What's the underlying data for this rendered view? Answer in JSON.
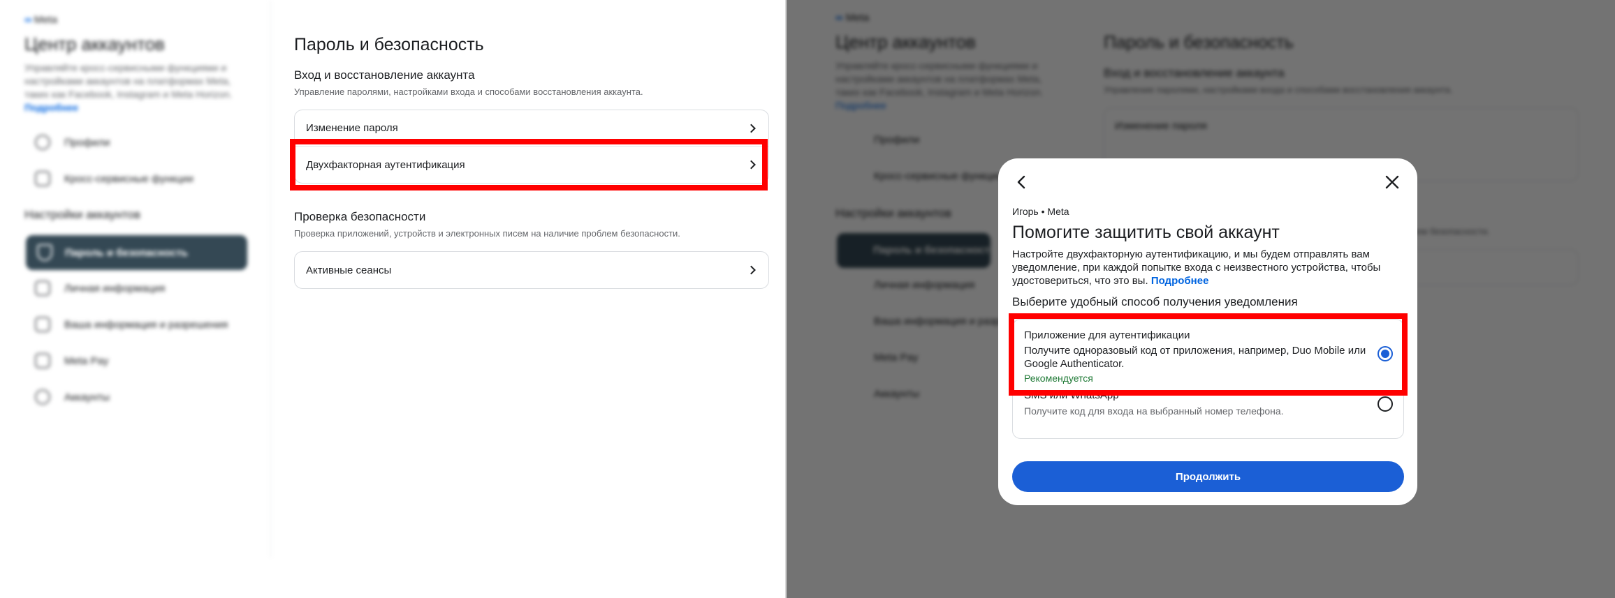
{
  "brand": {
    "logo_text": "Meta"
  },
  "sidebar": {
    "title": "Центр аккаунтов",
    "description": "Управляйте кросс-сервисными функциями и настройками аккаунтов на платформах Meta, таких как Facebook, Instagram и Meta Horizon.",
    "more_link": "Подробнее",
    "items": [
      {
        "label": "Профили",
        "icon": "user-icon"
      },
      {
        "label": "Кросс-сервисные функции",
        "icon": "connections-icon"
      }
    ],
    "settings_title": "Настройки аккаунтов",
    "settings_items": [
      {
        "label": "Пароль и безопасность",
        "icon": "shield-icon",
        "active": true
      },
      {
        "label": "Личная информация",
        "icon": "id-card-icon"
      },
      {
        "label": "Ваша информация и разрешения",
        "icon": "document-lock-icon"
      },
      {
        "label": "Meta Pay",
        "icon": "card-icon"
      },
      {
        "label": "Аккаунты",
        "icon": "account-circle-icon"
      }
    ]
  },
  "main": {
    "title": "Пароль и безопасность",
    "login_section": {
      "title": "Вход и восстановление аккаунта",
      "description": "Управление паролями, настройками входа и способами восстановления аккаунта.",
      "rows": [
        "Изменение пароля",
        "Двухфакторная аутентификация"
      ]
    },
    "security_section": {
      "title": "Проверка безопасности",
      "description": "Проверка приложений, устройств и электронных писем на наличие проблем безопасности.",
      "rows": [
        "Активные сеансы"
      ]
    }
  },
  "modal": {
    "crumb": "Игорь • Meta",
    "title": "Помогите защитить свой аккаунт",
    "description": "Настройте двухфакторную аутентификацию, и мы будем отправлять вам уведомление, при каждой попытке входа с неизвестного устройства, чтобы удостовериться, что это вы.",
    "more_link": "Подробнее",
    "choose_label": "Выберите удобный способ получения уведомления",
    "options": [
      {
        "title": "Приложение для аутентификации",
        "description": "Получите одноразовый код от приложения, например, Duo Mobile или Google Authenticator.",
        "badge": "Рекомендуется",
        "selected": true
      },
      {
        "title": "SMS или WhatsApp",
        "description": "Получите код для входа на выбранный номер телефона.",
        "selected": false
      }
    ],
    "continue_label": "Продолжить"
  },
  "colors": {
    "accent": "#1b5fd6",
    "highlight": "#ff0000",
    "sidebar_active": "#344854",
    "recommended": "#1f7a36"
  }
}
